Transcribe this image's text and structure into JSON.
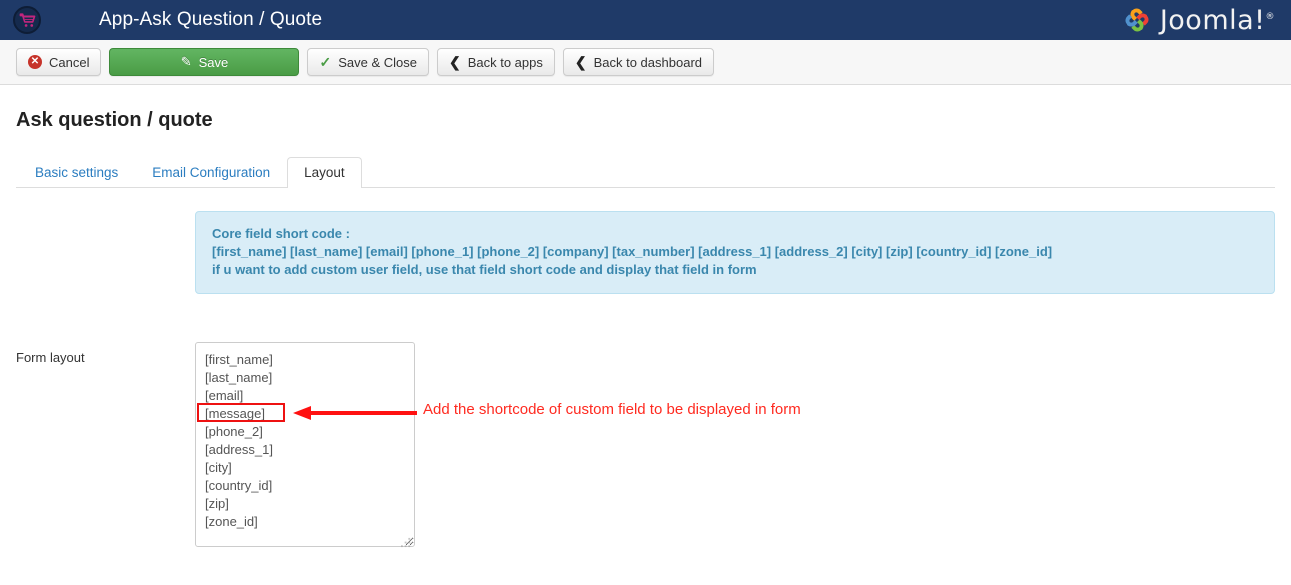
{
  "header": {
    "app_icon": "shopping-cart-icon",
    "title": "App-Ask Question / Quote",
    "brand": "Joomla!",
    "brand_reg": "®",
    "bar_color": "#1f3a68"
  },
  "toolbar": {
    "buttons": [
      {
        "label": "Cancel",
        "icon": "cancel-circle-icon",
        "style": "default"
      },
      {
        "label": "Save",
        "icon": "edit-pencil-icon",
        "style": "primary-green"
      },
      {
        "label": "Save & Close",
        "icon": "check-icon",
        "style": "default"
      },
      {
        "label": "Back to apps",
        "icon": "chevron-left-icon",
        "style": "default"
      },
      {
        "label": "Back to dashboard",
        "icon": "chevron-left-icon",
        "style": "default"
      }
    ],
    "save_accent": "#4a9c45"
  },
  "page": {
    "title": "Ask question / quote"
  },
  "tabs": [
    {
      "label": "Basic settings",
      "active": false
    },
    {
      "label": "Email Configuration",
      "active": false
    },
    {
      "label": "Layout",
      "active": true
    }
  ],
  "info_box": {
    "line1": "Core field short code :",
    "line2": "[first_name] [last_name] [email] [phone_1] [phone_2] [company] [tax_number] [address_1] [address_2] [city] [zip] [country_id] [zone_id]",
    "line3": "if u want to add custom user field, use that field short code and display that field in form",
    "bg_color": "#d9edf7",
    "text_color": "#3a87ad"
  },
  "form": {
    "label": "Form layout",
    "textarea_value": "[first_name]\n[last_name]\n[email]\n[message]\n[phone_2]\n[address_1]\n[city]\n[country_id]\n[zip]\n[zone_id]",
    "textarea_lines": [
      "[first_name]",
      "[last_name]",
      "[email]",
      "[message]",
      "[phone_2]",
      "[address_1]",
      "[city]",
      "[country_id]",
      "[zip]",
      "[zone_id]"
    ]
  },
  "annotation": {
    "text": "Add the shortcode of custom field to be displayed in form",
    "color": "#ff2a20",
    "highlighted_line": "[message]"
  }
}
